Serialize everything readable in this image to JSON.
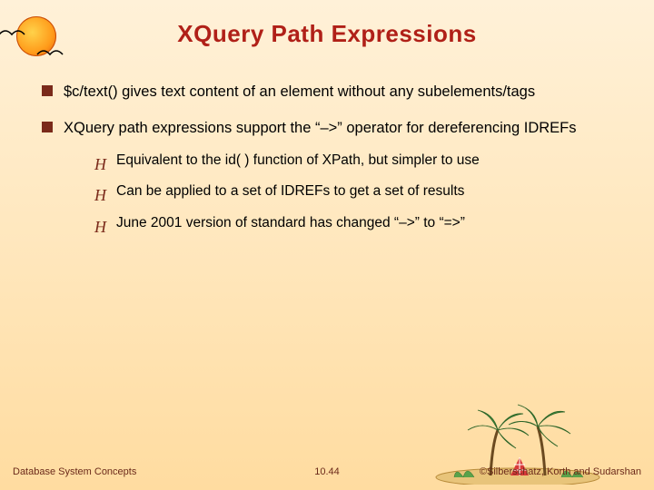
{
  "title": "XQuery Path Expressions",
  "bullets": {
    "b1": "$c/text() gives text content of an element without any subelements/tags",
    "b2": "XQuery path expressions support the “–>” operator for dereferencing IDREFs",
    "b2_sub": {
      "s1": "Equivalent to the id( ) function of XPath, but simpler to use",
      "s2": "Can be applied to a set of IDREFs to get a set of results",
      "s3": "June 2001 version of standard has changed   “–>” to “=>”"
    }
  },
  "footer": {
    "left": "Database System Concepts",
    "center": "10.44",
    "right": "©Silberschatz, Korth and Sudarshan"
  },
  "sub_marker": "H"
}
